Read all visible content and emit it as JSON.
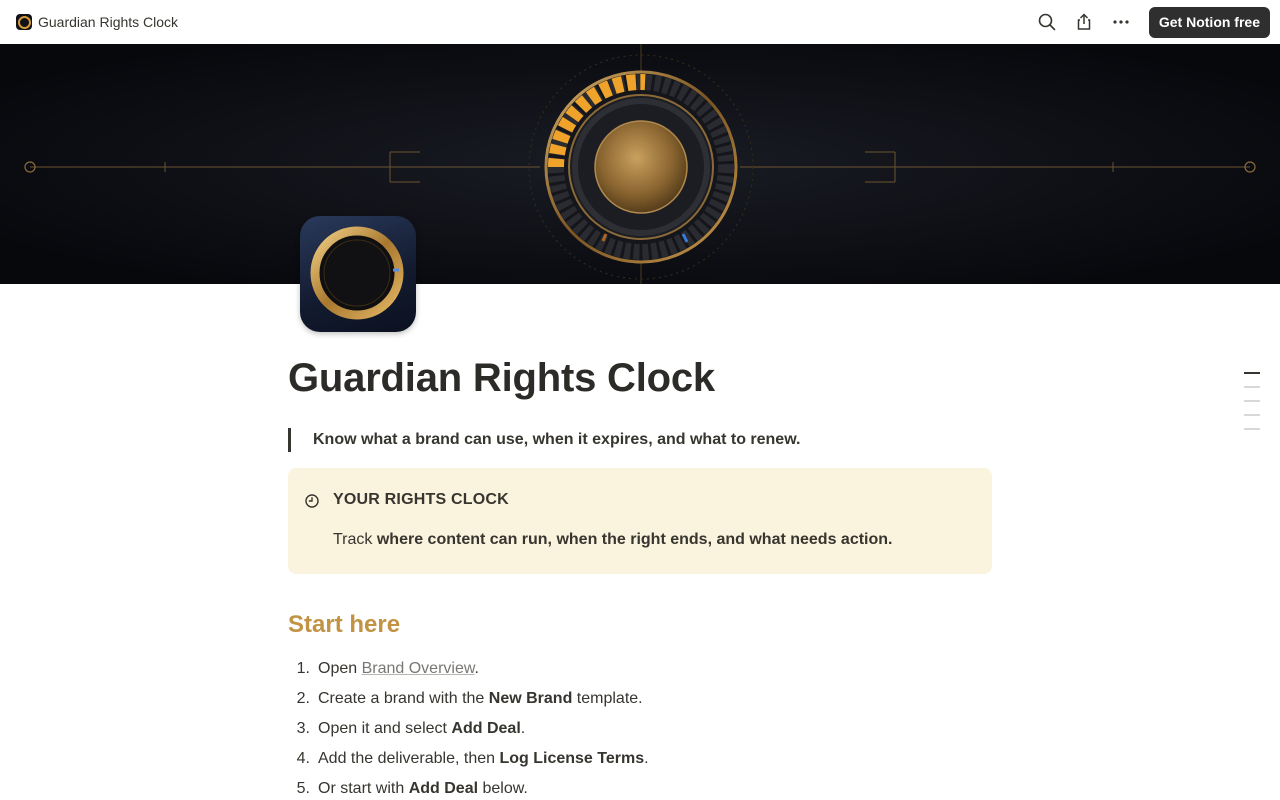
{
  "topbar": {
    "site_title": "Guardian Rights Clock",
    "cta_label": "Get Notion free",
    "icons": [
      "search-icon",
      "share-icon",
      "more-icon"
    ]
  },
  "page": {
    "title": "Guardian Rights Clock",
    "quote": "Know what a brand can use, when it expires, and what to renew."
  },
  "callout": {
    "icon": "clock-icon",
    "title": "YOUR RIGHTS CLOCK",
    "body_plain": "Track",
    "body_bold": "where content can run, when the right ends, and what needs action."
  },
  "start_here": {
    "heading": "Start here",
    "steps": [
      {
        "num": "1.",
        "a": "Open ",
        "link": "Brand Overview",
        "b": "."
      },
      {
        "num": "2.",
        "a": "Create a brand with the ",
        "bold": "New Brand",
        "b": " template."
      },
      {
        "num": "3.",
        "a": "Open it and select ",
        "bold": "Add Deal",
        "b": "."
      },
      {
        "num": "4.",
        "a": "Add the deliverable, then ",
        "bold": "Log License Terms",
        "b": "."
      },
      {
        "num": "5.",
        "a": "Or start with ",
        "bold": "Add Deal",
        "b": " below."
      }
    ]
  },
  "colors": {
    "accent_gold": "#c29343",
    "callout_bg": "#faf3dd",
    "cta_bg": "#2f2f2f"
  }
}
